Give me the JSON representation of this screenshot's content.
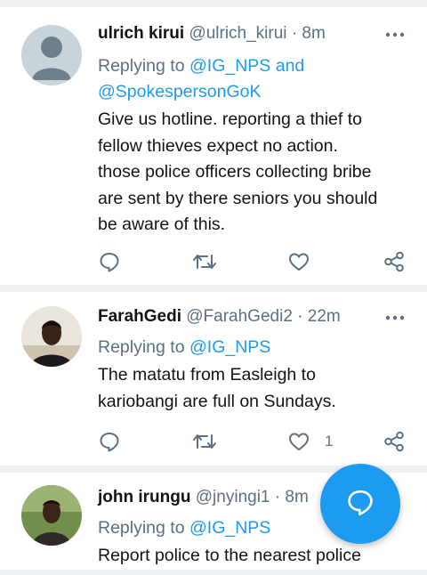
{
  "tweets": [
    {
      "name": "ulrich kirui",
      "handle": "@ulrich_kirui",
      "separator": "·",
      "time": "8m",
      "replying_prefix": "Replying to ",
      "replying_line1": "@IG_NPS and",
      "replying_line2": "@SpokespersonGoK",
      "text": "Give us hotline. reporting a thief to\nfellow thieves expect no action.\nthose police officers collecting bribe\nare sent by there seniors you should\nbe aware of this.",
      "likes": ""
    },
    {
      "name": "FarahGedi",
      "handle": "@FarahGedi2",
      "separator": "·",
      "time": "22m",
      "replying_prefix": "Replying to ",
      "replying_line1": "@IG_NPS",
      "text": "The matatu from Easleigh to\nkariobangi are full on Sundays.",
      "likes": "1"
    },
    {
      "name": "john irungu",
      "handle": "@jnyingi1",
      "separator": "·",
      "time": "8m",
      "replying_prefix": "Replying to ",
      "replying_line1": "@IG_NPS",
      "text": "Report police to the nearest police"
    }
  ],
  "icons": {
    "more": "more-horizontal-icon",
    "reply": "reply-bubble-icon",
    "retweet": "retweet-icon",
    "like": "heart-icon",
    "share": "share-icon",
    "compose": "compose-reply-icon"
  },
  "colors": {
    "accent": "#1d9bf0",
    "secondary_text": "#5b7083",
    "divider": "#eef1f3"
  }
}
